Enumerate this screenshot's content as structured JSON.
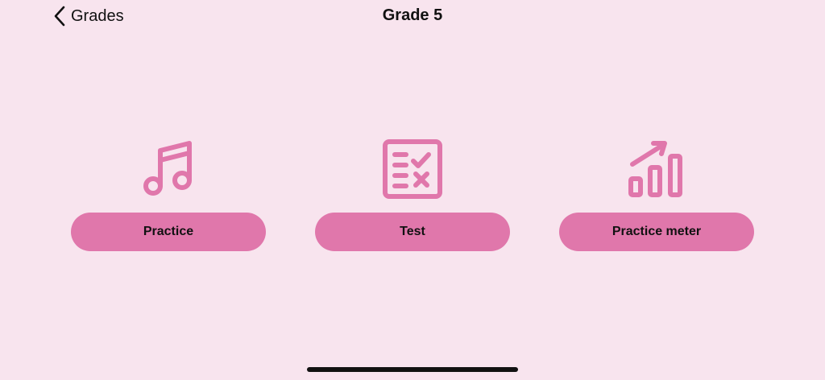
{
  "nav": {
    "back_label": "Grades",
    "title": "Grade 5"
  },
  "tiles": [
    {
      "label": "Practice",
      "icon": "music-note-icon"
    },
    {
      "label": "Test",
      "icon": "checklist-icon"
    },
    {
      "label": "Practice meter",
      "icon": "progress-chart-icon"
    }
  ],
  "colors": {
    "background": "#f8e4ee",
    "accent": "#e077ab",
    "text": "#111111"
  }
}
